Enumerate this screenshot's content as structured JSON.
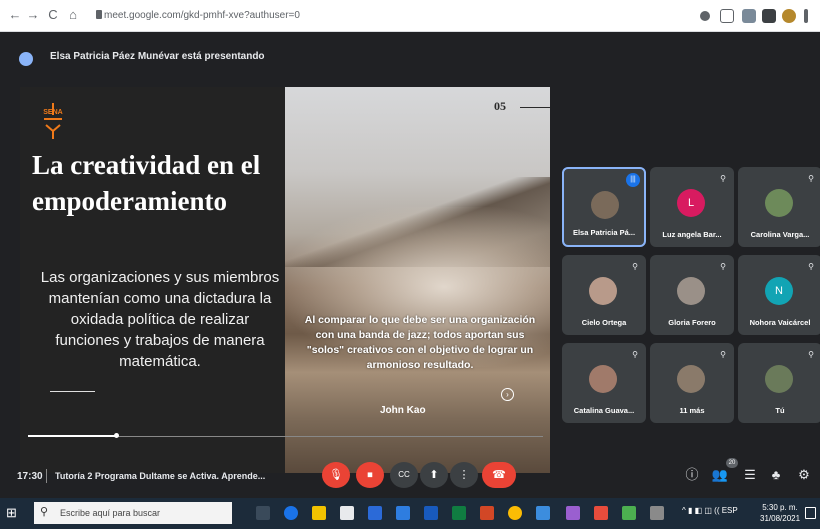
{
  "browser": {
    "url": "meet.google.com/gkd-pmhf-xve?authuser=0",
    "nav": {
      "back": "←",
      "forward": "→",
      "reload": "C",
      "home": "⌂"
    }
  },
  "presenter": {
    "text": "Elsa Patricia Páez Munévar está presentando"
  },
  "slide": {
    "number": "05",
    "logo_text": "SENA",
    "title": "La creatividad en el empoderamiento",
    "body": "Las organizaciones y sus miembros mantenían como una dictadura la oxidada política de realizar funciones y trabajos de manera matemática.",
    "quote": "Al comparar lo que debe ser una organización con una banda de jazz; todos aportan sus \"solos\" creativos con el objetivo de lograr un armonioso resultado.",
    "quote_author": "John Kao",
    "progress": 0.17
  },
  "participants": [
    {
      "name": "Elsa Patricia Pá...",
      "initial": "",
      "color": "#7a6a5a",
      "active": true
    },
    {
      "name": "Luz angela Bar...",
      "initial": "L",
      "color": "#d81b60",
      "active": false
    },
    {
      "name": "Carolina Varga...",
      "initial": "",
      "color": "#6d8a5a",
      "active": false
    },
    {
      "name": "Cielo Ortega",
      "initial": "",
      "color": "#b89a8a",
      "active": false
    },
    {
      "name": "Gloria Forero",
      "initial": "",
      "color": "#9a9088",
      "active": false
    },
    {
      "name": "Nohora Vaicárcel",
      "initial": "N",
      "color": "#12a4b4",
      "active": false
    },
    {
      "name": "Catalina Guava...",
      "initial": "",
      "color": "#a07a6a",
      "active": false
    },
    {
      "name": "11 más",
      "initial": "",
      "color": "#8a7a6a",
      "active": false
    },
    {
      "name": "Tú",
      "initial": "",
      "color": "#6a7a5a",
      "active": false
    }
  ],
  "meeting": {
    "time": "17:30",
    "title": "Tutoría 2 Programa Dultame se Activa. Aprende...",
    "people_count": "20"
  },
  "controls": {
    "mic": "🎙",
    "camera": "⏹",
    "captions": "CC",
    "present": "⬆",
    "more": "⋮",
    "end": "☎"
  },
  "right_icons": {
    "info": "ⓘ",
    "people": "👥",
    "chat": "☰",
    "activities": "♣",
    "safety": "⚙"
  },
  "taskbar": {
    "search_placeholder": "Escribe aquí para buscar",
    "tray": "^ ▮ ◧ ◫ (( ESP",
    "clock_time": "5:30 p. m.",
    "clock_date": "31/08/2021"
  }
}
